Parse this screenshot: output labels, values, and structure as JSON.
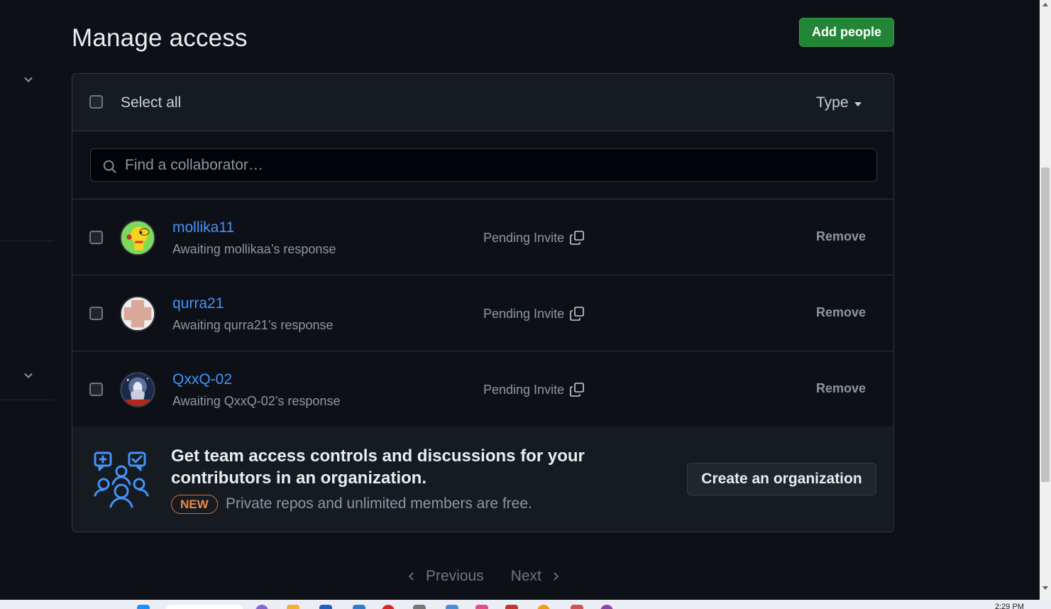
{
  "page": {
    "title": "Manage access",
    "add_people_label": "Add people"
  },
  "list_header": {
    "select_all_label": "Select all",
    "type_filter_label": "Type"
  },
  "search": {
    "placeholder": "Find a collaborator…",
    "value": ""
  },
  "collaborators": [
    {
      "username": "mollika11",
      "subtitle": "Awaiting mollikaa’s response",
      "status": "Pending Invite",
      "remove_label": "Remove",
      "avatar": "yellow-cartoon-avatar"
    },
    {
      "username": "qurra21",
      "subtitle": "Awaiting qurra21’s response",
      "status": "Pending Invite",
      "remove_label": "Remove",
      "avatar": "identicon-avatar"
    },
    {
      "username": "QxxQ-02",
      "subtitle": "Awaiting QxxQ-02’s response",
      "status": "Pending Invite",
      "remove_label": "Remove",
      "avatar": "anime-avatar"
    }
  ],
  "promo": {
    "title": "Get team access controls and discussions for your contributors in an organization.",
    "badge": "NEW",
    "note": "Private repos and unlimited members are free.",
    "cta_label": "Create an organization",
    "icon": "people-discussion-icon"
  },
  "pagination": {
    "previous_label": "Previous",
    "next_label": "Next"
  },
  "taskbar": {
    "clock": "2:29 PM"
  },
  "colors": {
    "background": "#0d1117",
    "primary_button": "#238636",
    "link": "#4493f8",
    "new_badge": "#db6d28"
  }
}
